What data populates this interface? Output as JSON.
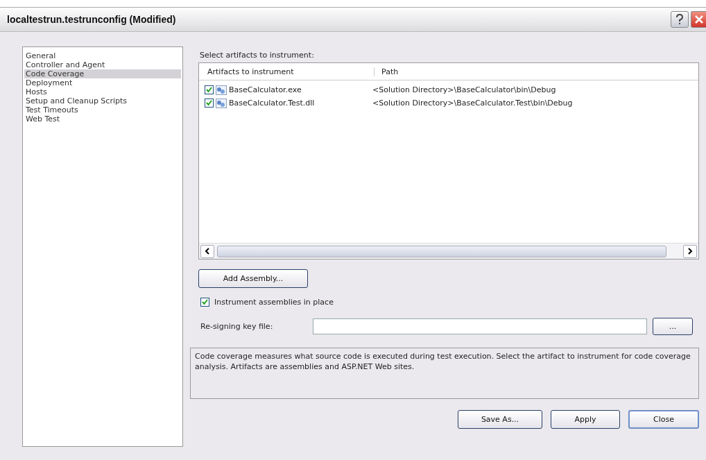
{
  "window": {
    "title": "localtestrun.testrunconfig (Modified)"
  },
  "sidebar": {
    "items": [
      {
        "label": "General",
        "selected": false
      },
      {
        "label": "Controller and Agent",
        "selected": false
      },
      {
        "label": "Code Coverage",
        "selected": true
      },
      {
        "label": "Deployment",
        "selected": false
      },
      {
        "label": "Hosts",
        "selected": false
      },
      {
        "label": "Setup and Cleanup Scripts",
        "selected": false
      },
      {
        "label": "Test Timeouts",
        "selected": false
      },
      {
        "label": "Web Test",
        "selected": false
      }
    ]
  },
  "artifacts": {
    "label": "Select artifacts to instrument:",
    "columns": [
      "Artifacts to instrument",
      "Path"
    ],
    "rows": [
      {
        "name": "BaseCalculator.exe",
        "path": "<Solution Directory>\\BaseCalculator\\bin\\Debug",
        "checked": true
      },
      {
        "name": "BaseCalculator.Test.dll",
        "path": "<Solution Directory>\\BaseCalculator.Test\\bin\\Debug",
        "checked": true
      }
    ]
  },
  "add_button": "Add Assembly...",
  "instrument_in_place": {
    "label": "Instrument assemblies in place",
    "checked": true
  },
  "resigning": {
    "label": "Re-signing key file:",
    "browse": "..."
  },
  "description": "Code coverage measures what source code is executed during test execution. Select the artifact to instrument for code coverage analysis. Artifacts are assemblies and ASP.NET Web sites.",
  "buttons": [
    "Save As...",
    "Apply",
    "Close"
  ]
}
